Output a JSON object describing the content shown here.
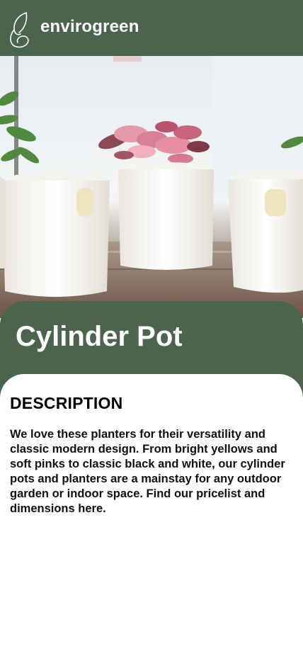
{
  "header": {
    "brand": "envirogreen",
    "logo_icon": "leaf-logo-icon"
  },
  "hero": {
    "image_subject": "white cylinder pots with pink and green plants"
  },
  "product": {
    "title": "Cylinder Pot"
  },
  "description": {
    "heading": "DESCRIPTION",
    "body": "We love these planters for their versatility and classic modern design. From bright yellows and soft pinks to classic black and white, our cylinder pots and planters are a mainstay for any outdoor garden or indoor space. Find our pricelist and dimensions here."
  },
  "colors": {
    "brand_green": "#4a644d",
    "background": "#ffffff",
    "text": "#111111"
  }
}
